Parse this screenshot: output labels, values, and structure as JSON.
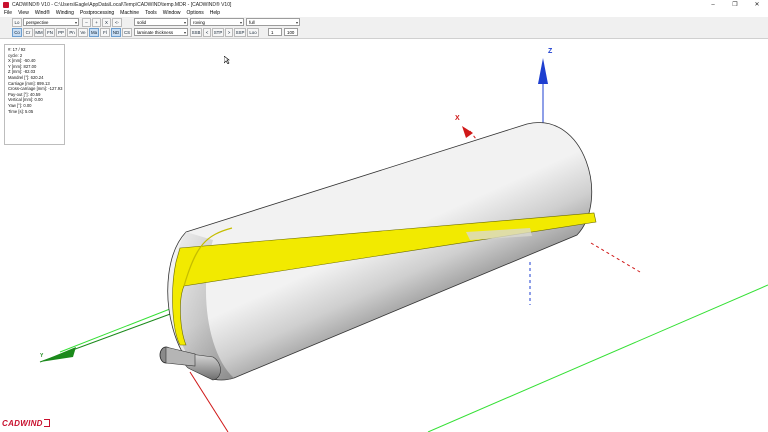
{
  "window": {
    "title": "CADWIND® V10 - C:\\Users\\Eagle\\AppData\\Local\\Temp\\CADWIND\\temp.MDR - [CADWIND® V10]",
    "minimize_glyph": "–",
    "maximize_glyph": "❐",
    "close_glyph": "✕"
  },
  "menu": [
    "File",
    "View",
    "Wind®",
    "Winding",
    "Postprocessing",
    "Machine",
    "Tools",
    "Window",
    "Options",
    "Help"
  ],
  "toolbar": {
    "row1": {
      "lo_label": "Lo",
      "projection": "perspective",
      "btn_minus": "–",
      "btn_plus": "+",
      "btn_x": "X",
      "btn_arrow": "<-",
      "render_mode": "solid",
      "color_mode": "roving",
      "detail_mode": "full"
    },
    "row2": {
      "buttons": [
        "Co",
        "Cr",
        "MM",
        "FN",
        "PP",
        "Pn",
        "Ve",
        "Ma",
        "Fl",
        "ND",
        "CS"
      ],
      "display_option": "laminate thickness",
      "b_ssb": "SSB",
      "b_lt": "<",
      "b_stp": "STP",
      "b_gt": ">",
      "b_ssp": "SSP",
      "b_loo": "Loo",
      "step_value": "1",
      "percent_value": "100"
    }
  },
  "info": {
    "lines": [
      "#: 17 / 92",
      "cycle: 2",
      "X [mm]: -50.40",
      "Y [mm]: 827.00",
      "Z [mm]: -82.03",
      "Mandrel [°]: 620.24",
      "Carriage [mm]: 899.13",
      "Cross-carriage [mm]: -127.93",
      "Pay-out [°]: 40.59",
      "Vertical [mm]: 0.00",
      "Yaw [°]: 0.00",
      "Time [s]: 5.05"
    ]
  },
  "axes": {
    "x": "X",
    "y": "Y",
    "z": "Z"
  },
  "logo": {
    "text": "CADWIND"
  },
  "colors": {
    "accent_red": "#c8102e",
    "band_yellow": "#f2ea00",
    "axis_z": "#1e3fd0",
    "axis_x": "#d01818",
    "axis_y": "#1b8a1b",
    "grid": "#35e035"
  }
}
